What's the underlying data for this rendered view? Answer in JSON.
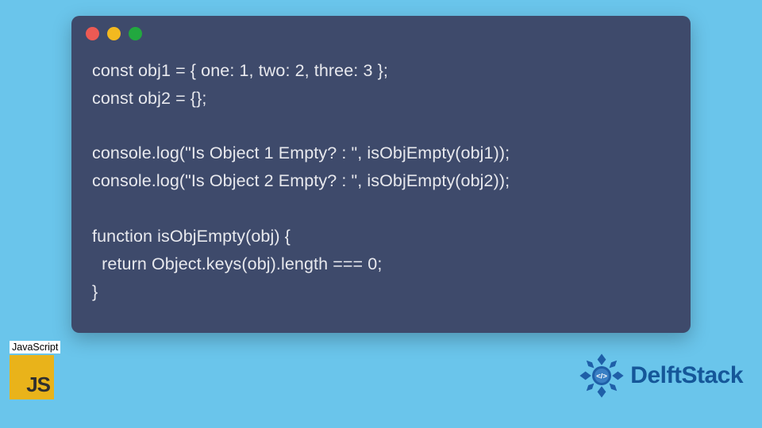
{
  "window": {
    "dots": [
      "red",
      "yellow",
      "green"
    ]
  },
  "code": {
    "lines": [
      "const obj1 = { one: 1, two: 2, three: 3 };",
      "const obj2 = {};",
      "",
      "console.log(\"Is Object 1 Empty? : \", isObjEmpty(obj1));",
      "console.log(\"Is Object 2 Empty? : \", isObjEmpty(obj2));",
      "",
      "function isObjEmpty(obj) {",
      "  return Object.keys(obj).length === 0;",
      "}"
    ]
  },
  "js_badge": {
    "label": "JavaScript",
    "logo_text": "JS"
  },
  "brand": {
    "name": "DelftStack"
  },
  "colors": {
    "page_bg": "#6ac5eb",
    "window_bg": "#3e4a6b",
    "code_fg": "#e8e9ee",
    "js_yellow": "#e9b31a",
    "brand_blue": "#155799"
  }
}
